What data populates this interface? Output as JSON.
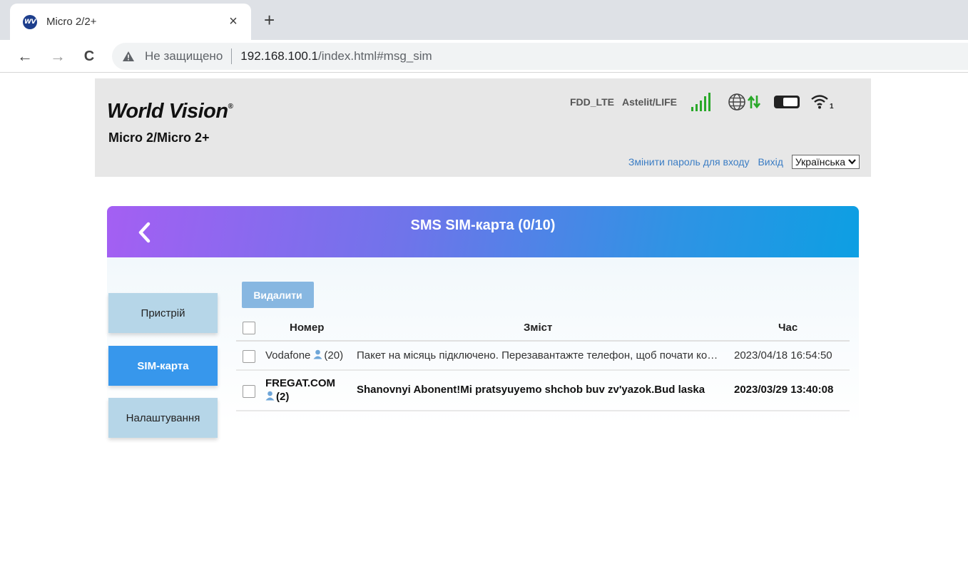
{
  "browser": {
    "tab_title": "Micro 2/2+",
    "favicon_text": "WV",
    "close_glyph": "×",
    "new_tab_glyph": "+",
    "back_glyph": "←",
    "forward_glyph": "→",
    "reload_glyph": "C",
    "security_label": "Не защищено",
    "url_host": "192.168.100.1",
    "url_path": "/index.html#msg_sim"
  },
  "header": {
    "brand": "World Vision",
    "brand_mark": "®",
    "model": "Micro 2/Micro 2+",
    "network_type": "FDD_LTE",
    "operator": "Astelit/LIFE",
    "wifi_clients": "1",
    "change_password": "Змінити пароль для входу",
    "logout": "Вихід",
    "language": "Українська",
    "colors": {
      "signal": "#29a829",
      "link": "#3b7dc4"
    }
  },
  "panel": {
    "title": "SMS SIM-карта (0/10)",
    "sidebar": [
      {
        "label": "Пристрій",
        "active": false
      },
      {
        "label": "SIM-карта",
        "active": true
      },
      {
        "label": "Налаштування",
        "active": false
      }
    ],
    "delete_label": "Видалити",
    "columns": {
      "number": "Номер",
      "content": "Зміст",
      "time": "Час"
    },
    "messages": [
      {
        "number": "Vodafone",
        "count": "(20)",
        "content": "Пакет на місяць підключено. Перезавантажте телефон, щоб почати користуватися послугою",
        "time": "2023/04/18 16:54:50"
      },
      {
        "number": "FREGAT.COM",
        "count": "(2)",
        "content": "Shanovnyi Abonent!Mi pratsyuyemo shchob buv zv'yazok.Bud laska",
        "time": "2023/03/29 13:40:08"
      }
    ]
  }
}
